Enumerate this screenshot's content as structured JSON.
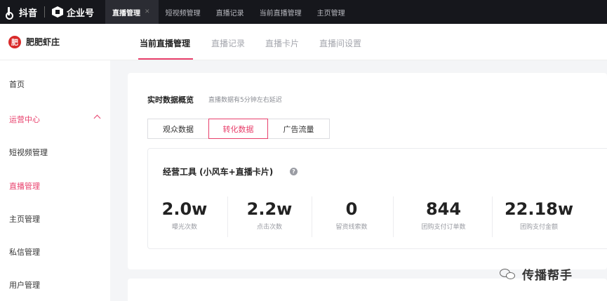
{
  "topbar": {
    "app_name": "抖音",
    "enterprise_name": "企业号",
    "tabs": [
      {
        "label": "直播管理"
      },
      {
        "label": "短视频管理"
      },
      {
        "label": "直播记录"
      },
      {
        "label": "当前直播管理"
      },
      {
        "label": "主页管理"
      }
    ]
  },
  "sidebar": {
    "account_name": "肥肥虾庄",
    "avatar_text": "肥",
    "items": [
      {
        "label": "首页"
      },
      {
        "label": "运营中心"
      },
      {
        "label": "短视频管理"
      },
      {
        "label": "直播管理"
      },
      {
        "label": "主页管理"
      },
      {
        "label": "私信管理"
      },
      {
        "label": "用户管理"
      }
    ]
  },
  "subtabs": [
    {
      "label": "当前直播管理"
    },
    {
      "label": "直播记录"
    },
    {
      "label": "直播卡片"
    },
    {
      "label": "直播间设置"
    }
  ],
  "overview": {
    "title": "实时数据概览",
    "note": "直播数据有5分钟左右延迟",
    "segments": [
      {
        "label": "观众数据"
      },
      {
        "label": "转化数据"
      },
      {
        "label": "广告流量"
      }
    ],
    "tools_title": "经营工具 (小风车+直播卡片)",
    "stats": [
      {
        "value": "2.0w",
        "label": "曝光次数"
      },
      {
        "value": "2.2w",
        "label": "点击次数"
      },
      {
        "value": "0",
        "label": "留资线索数"
      },
      {
        "value": "844",
        "label": "团购支付订单数"
      },
      {
        "value": "22.18w",
        "label": "团购支付金额"
      }
    ]
  },
  "watermark": {
    "text": "传播帮手"
  },
  "colors": {
    "accent": "#e8406c",
    "topbar": "#16171c"
  }
}
